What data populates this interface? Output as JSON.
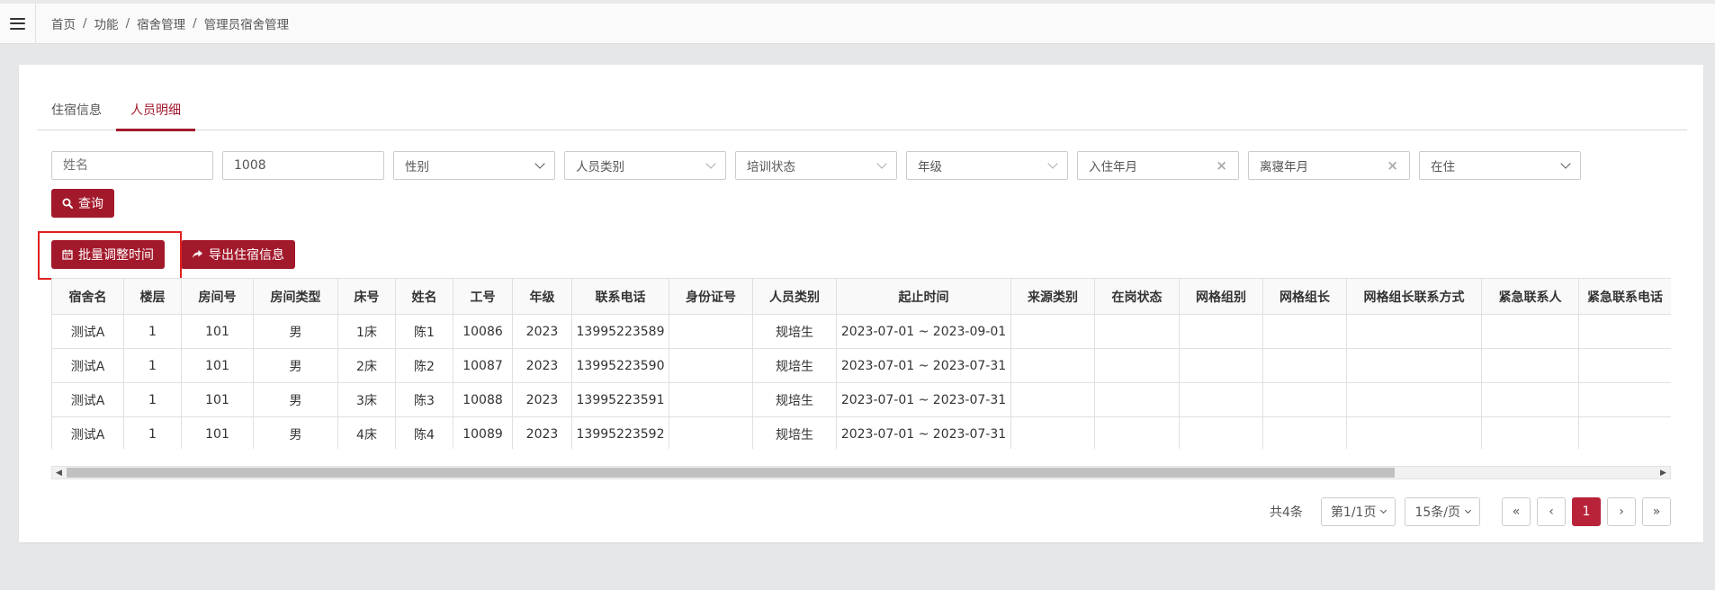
{
  "breadcrumb": [
    "首页",
    "功能",
    "宿舍管理",
    "管理员宿舍管理"
  ],
  "breadcrumb_sep": "/",
  "tabs": [
    {
      "label": "住宿信息",
      "active": false
    },
    {
      "label": "人员明细",
      "active": true
    }
  ],
  "filters": {
    "name_placeholder": "姓名",
    "number_value": "1008",
    "gender": "性别",
    "person_type": "人员类别",
    "training_status": "培训状态",
    "grade": "年级",
    "checkin_month": "入住年月",
    "checkout_month": "离寝年月",
    "residence_status": "在住",
    "clear_glyph": "×"
  },
  "buttons": {
    "query": "查询",
    "batch_adjust": "批量调整时间",
    "export": "导出住宿信息"
  },
  "table": {
    "columns": [
      "宿舍名",
      "楼层",
      "房间号",
      "房间类型",
      "床号",
      "姓名",
      "工号",
      "年级",
      "联系电话",
      "身份证号",
      "人员类别",
      "起止时间",
      "来源类别",
      "在岗状态",
      "网格组别",
      "网格组长",
      "网格组长联系方式",
      "紧急联系人",
      "紧急联系电话"
    ],
    "rows": [
      [
        "测试A",
        "1",
        "101",
        "男",
        "1床",
        "陈1",
        "10086",
        "2023",
        "13995223589",
        "",
        "规培生",
        "2023-07-01 ~ 2023-09-01",
        "",
        "",
        "",
        "",
        "",
        "",
        ""
      ],
      [
        "测试A",
        "1",
        "101",
        "男",
        "2床",
        "陈2",
        "10087",
        "2023",
        "13995223590",
        "",
        "规培生",
        "2023-07-01 ~ 2023-07-31",
        "",
        "",
        "",
        "",
        "",
        "",
        ""
      ],
      [
        "测试A",
        "1",
        "101",
        "男",
        "3床",
        "陈3",
        "10088",
        "2023",
        "13995223591",
        "",
        "规培生",
        "2023-07-01 ~ 2023-07-31",
        "",
        "",
        "",
        "",
        "",
        "",
        ""
      ],
      [
        "测试A",
        "1",
        "101",
        "男",
        "4床",
        "陈4",
        "10089",
        "2023",
        "13995223592",
        "",
        "规培生",
        "2023-07-01 ~ 2023-07-31",
        "",
        "",
        "",
        "",
        "",
        "",
        ""
      ]
    ]
  },
  "scrollbar": {
    "left_arrow": "◀",
    "right_arrow": "▶"
  },
  "pagination": {
    "total": "共4条",
    "page_select": "第1/1页",
    "size_select": "15条/页",
    "first": "«",
    "prev": "‹",
    "current": "1",
    "next": "›",
    "last": "»"
  },
  "colors": {
    "accent": "#a3192c",
    "highlight": "#e02020"
  }
}
